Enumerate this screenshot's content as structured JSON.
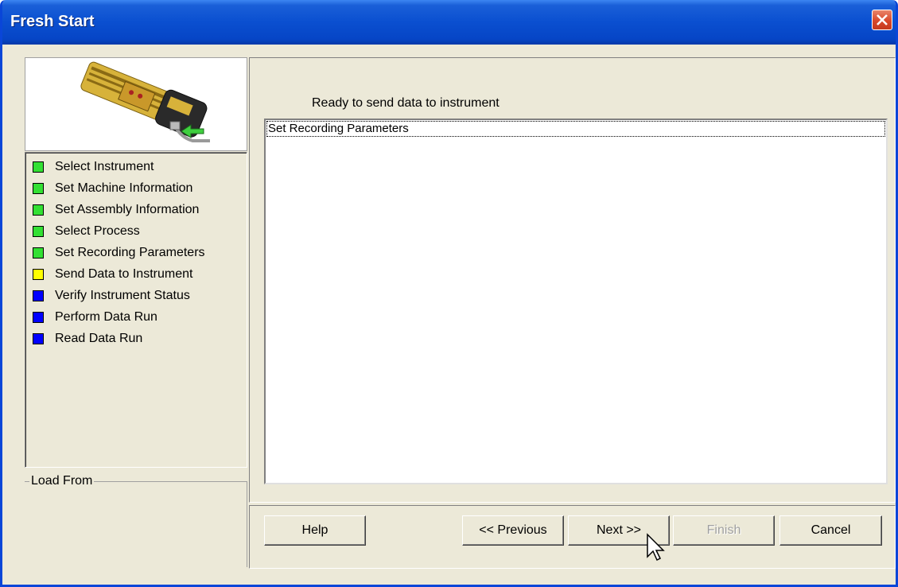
{
  "window": {
    "title": "Fresh Start"
  },
  "steps": [
    {
      "label": "Select Instrument",
      "status_color": "#33e033"
    },
    {
      "label": "Set Machine Information",
      "status_color": "#33e033"
    },
    {
      "label": "Set Assembly Information",
      "status_color": "#33e033"
    },
    {
      "label": "Select Process",
      "status_color": "#33e033"
    },
    {
      "label": "Set Recording Parameters",
      "status_color": "#33e033"
    },
    {
      "label": "Send Data to Instrument",
      "status_color": "#ffff00"
    },
    {
      "label": "Verify Instrument Status",
      "status_color": "#0000ff"
    },
    {
      "label": "Perform Data Run",
      "status_color": "#0000ff"
    },
    {
      "label": "Read Data Run",
      "status_color": "#0000ff"
    }
  ],
  "load_from": {
    "label": "Load From"
  },
  "main": {
    "ready_text": "Ready to send data to instrument",
    "list_items": [
      "Set Recording Parameters"
    ]
  },
  "buttons": {
    "help": "Help",
    "previous": "<< Previous",
    "next": "Next >>",
    "finish": "Finish",
    "cancel": "Cancel"
  }
}
